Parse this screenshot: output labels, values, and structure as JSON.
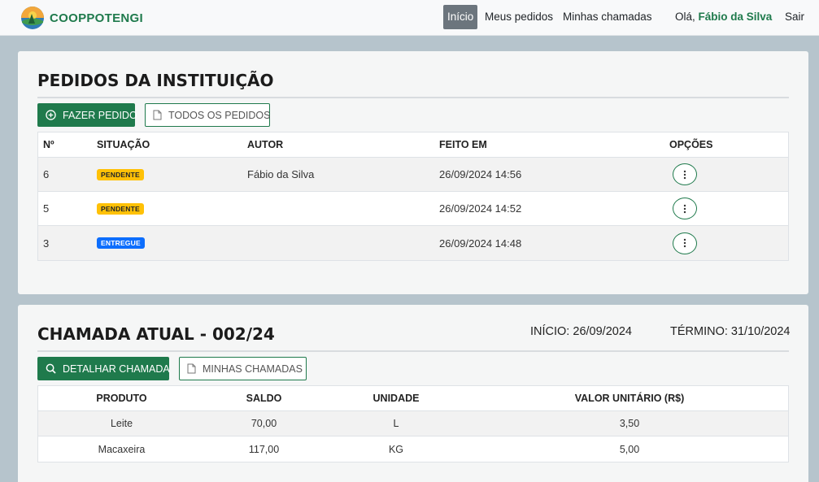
{
  "nav": {
    "brand": "COOPPOTENGI",
    "links": [
      "Início",
      "Meus pedidos",
      "Minhas chamadas"
    ],
    "greeting_prefix": "Olá, ",
    "user_name": "Fábio da Silva",
    "logout": "Sair"
  },
  "orders": {
    "title": "PEDIDOS DA INSTITUIÇÃO",
    "new_order_button": "FAZER PEDIDO",
    "all_orders_button": "TODOS OS PEDIDOS",
    "columns": [
      "Nº",
      "SITUAÇÃO",
      "AUTOR",
      "FEITO EM",
      "OPÇÕES"
    ],
    "rows": [
      {
        "number": "6",
        "status": "PENDENTE",
        "author": "Fábio da Silva",
        "date": "26/09/2024 14:56"
      },
      {
        "number": "5",
        "status": "PENDENTE",
        "author": "",
        "date": "26/09/2024 14:52"
      },
      {
        "number": "3",
        "status": "ENTREGUE",
        "author": "",
        "date": "26/09/2024 14:48"
      }
    ]
  },
  "call": {
    "title": "CHAMADA ATUAL - 002/24",
    "start_label": "INÍCIO: ",
    "start_date": "26/09/2024",
    "end_label": "TÉRMINO: ",
    "end_date": "31/10/2024",
    "detail_button": "DETALHAR CHAMADA",
    "my_calls_button": "MINHAS CHAMADAS",
    "columns": [
      "PRODUTO",
      "SALDO",
      "UNIDADE",
      "VALOR UNITÁRIO (R$)"
    ],
    "rows": [
      {
        "product": "Leite",
        "balance": "70,00",
        "unit": "L",
        "price": "3,50"
      },
      {
        "product": "Macaxeira",
        "balance": "117,00",
        "unit": "KG",
        "price": "5,00"
      }
    ]
  },
  "colors": {
    "brand": "#1f7a4c",
    "pending": "#ffc107",
    "delivered": "#0d6efd",
    "background": "#b6c4cc"
  }
}
